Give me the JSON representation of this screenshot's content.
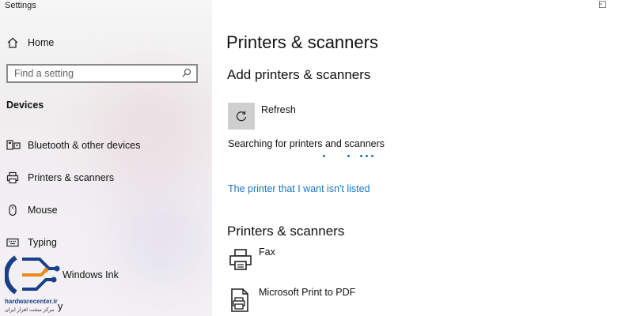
{
  "window": {
    "title": "Settings",
    "maximize_glyph": "☐"
  },
  "sidebar": {
    "home_label": "Home",
    "search_placeholder": "Find a setting",
    "section_title": "Devices",
    "items": [
      {
        "label": "Bluetooth & other devices",
        "icon": "bluetooth-devices-icon"
      },
      {
        "label": "Printers & scanners",
        "icon": "printer-icon"
      },
      {
        "label": "Mouse",
        "icon": "mouse-icon"
      },
      {
        "label": "Typing",
        "icon": "keyboard-icon"
      },
      {
        "label": "Windows Ink",
        "icon": "pen-icon"
      },
      {
        "label": "y",
        "icon": ""
      }
    ]
  },
  "main": {
    "page_title": "Printers & scanners",
    "add_section_title": "Add printers & scanners",
    "refresh_label": "Refresh",
    "searching_text": "Searching for printers and scanners",
    "not_listed_link": "The printer that I want isn't listed",
    "list_section_title": "Printers & scanners",
    "devices": [
      {
        "label": "Fax",
        "icon": "fax-printer-icon"
      },
      {
        "label": "Microsoft Print to PDF",
        "icon": "pdf-printer-icon"
      }
    ]
  },
  "watermark": {
    "brand": "hardwarecenter.ir",
    "tagline": "مرکز سخت افزار ایران"
  },
  "colors": {
    "accent": "#1a74c8",
    "tile": "#cfcfcf",
    "sidebar_bg": "#f3f1f3"
  }
}
